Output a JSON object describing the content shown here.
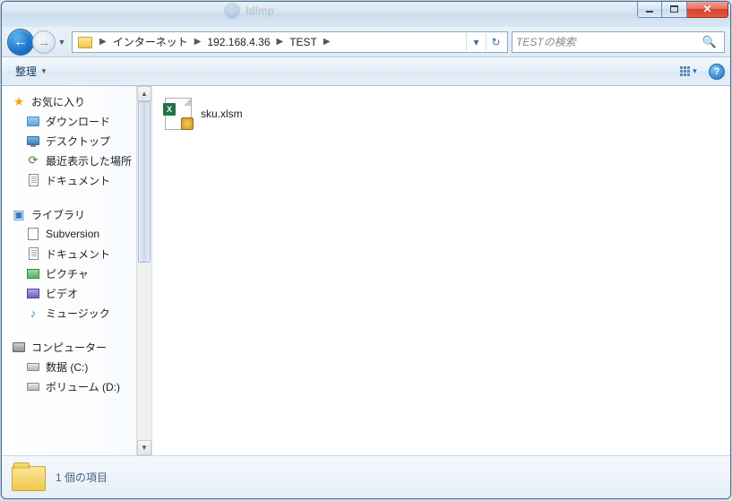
{
  "breadcrumb": {
    "seg1": "インターネット",
    "seg2": "192.168.4.36",
    "seg3": "TEST"
  },
  "search": {
    "placeholder": "TESTの検索"
  },
  "toolbar": {
    "organize": "整理"
  },
  "sidebar": {
    "favorites": {
      "label": "お気に入り",
      "items": [
        "ダウンロード",
        "デスクトップ",
        "最近表示した場所",
        "ドキュメント"
      ]
    },
    "libraries": {
      "label": "ライブラリ",
      "items": [
        "Subversion",
        "ドキュメント",
        "ピクチャ",
        "ビデオ",
        "ミュージック"
      ]
    },
    "computer": {
      "label": "コンピューター",
      "items": [
        "数据 (C:)",
        "ボリューム (D:)"
      ]
    }
  },
  "files": [
    {
      "name": "sku.xlsm"
    }
  ],
  "statusbar": {
    "text": "1 個の項目"
  },
  "ghost": {
    "text": "IdImp"
  }
}
